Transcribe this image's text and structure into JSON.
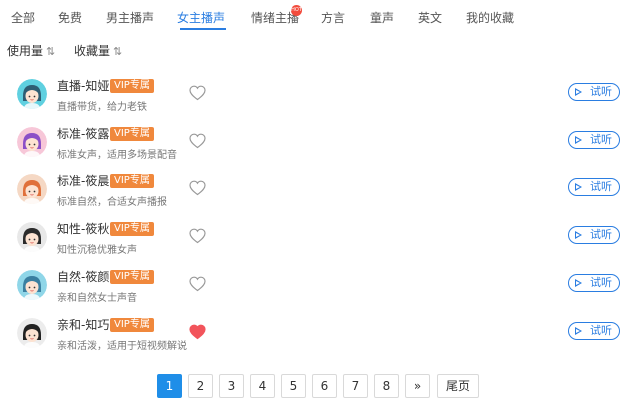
{
  "tabs": [
    {
      "label": "全部"
    },
    {
      "label": "免费"
    },
    {
      "label": "男主播声"
    },
    {
      "label": "女主播声",
      "active": true
    },
    {
      "label": "情绪主播",
      "badge": "HOT"
    },
    {
      "label": "方言"
    },
    {
      "label": "童声"
    },
    {
      "label": "英文"
    },
    {
      "label": "我的收藏"
    }
  ],
  "sort": {
    "usage_label": "使用量",
    "favorites_label": "收藏量",
    "icon": "sort-arrows-icon"
  },
  "voices": [
    {
      "name": "直播-知娅",
      "vip": "VIP专属",
      "desc": "直播带货，给力老铁",
      "favorited": false,
      "listen_label": "试听",
      "avatar_bg": "#5fd0e0",
      "hair": "#2e5d73"
    },
    {
      "name": "标准-筱露",
      "vip": "VIP专属",
      "desc": "标准女声，适用多场景配音",
      "favorited": false,
      "listen_label": "试听",
      "avatar_bg": "#f7c7d8",
      "hair": "#8b4fc7"
    },
    {
      "name": "标准-筱晨",
      "vip": "VIP专属",
      "desc": "标准自然，合适女声播报",
      "favorited": false,
      "listen_label": "试听",
      "avatar_bg": "#f5d8c4",
      "hair": "#e0703a"
    },
    {
      "name": "知性-筱秋",
      "vip": "VIP专属",
      "desc": "知性沉稳优雅女声",
      "favorited": false,
      "listen_label": "试听",
      "avatar_bg": "#e8e8e8",
      "hair": "#2b2b2b"
    },
    {
      "name": "自然-筱颜",
      "vip": "VIP专属",
      "desc": "亲和自然女士声音",
      "favorited": false,
      "listen_label": "试听",
      "avatar_bg": "#8fd6e8",
      "hair": "#3a7fa0"
    },
    {
      "name": "亲和-知巧",
      "vip": "VIP专属",
      "desc": "亲和活泼，适用于短视频解说",
      "favorited": true,
      "listen_label": "试听",
      "avatar_bg": "#ececec",
      "hair": "#222222"
    }
  ],
  "pagination": {
    "pages": [
      "1",
      "2",
      "3",
      "4",
      "5",
      "6",
      "7",
      "8"
    ],
    "current": "1",
    "next_label": "»",
    "last_label": "尾页"
  },
  "colors": {
    "accent": "#2a7de1",
    "vip": "#f0883c",
    "heart_active": "#f2545b",
    "heart_inactive": "#999999"
  }
}
